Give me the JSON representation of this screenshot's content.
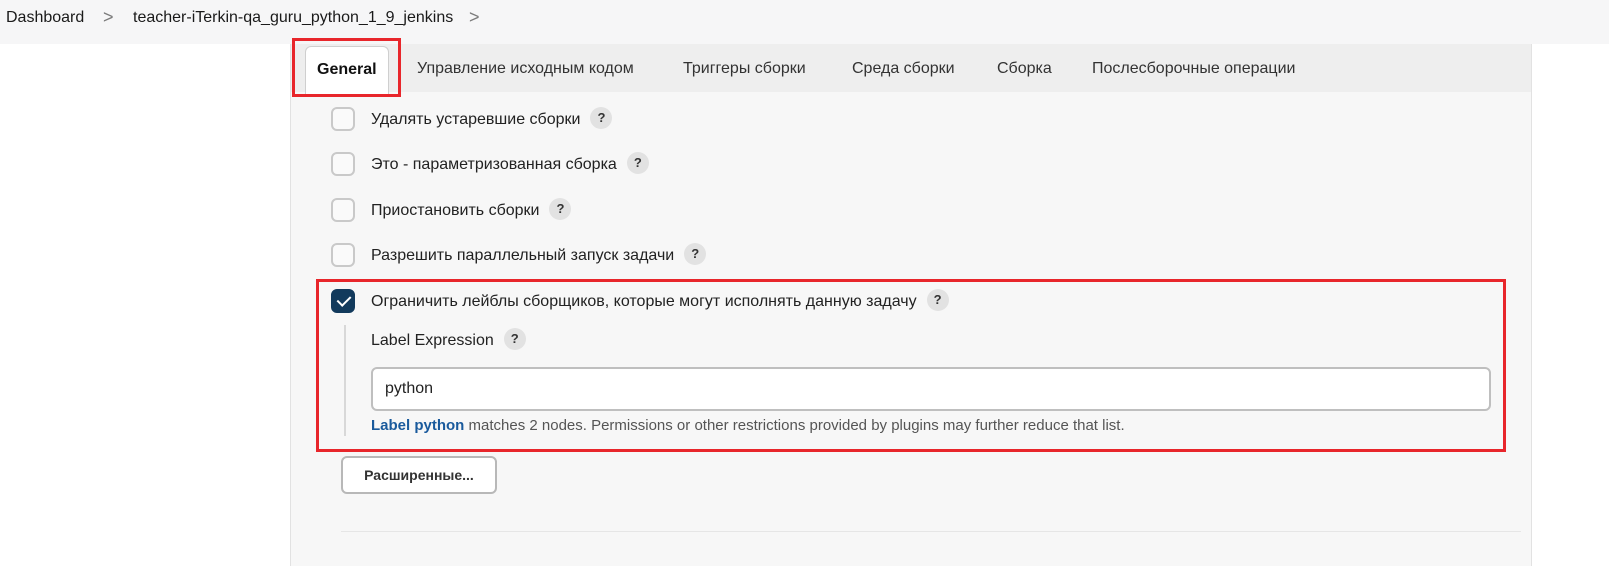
{
  "breadcrumb": {
    "items": [
      "Dashboard",
      "teacher-iTerkin-qa_guru_python_1_9_jenkins"
    ],
    "separator": ">"
  },
  "tabs": [
    {
      "label": "General",
      "active": true
    },
    {
      "label": "Управление исходным кодом",
      "active": false
    },
    {
      "label": "Триггеры сборки",
      "active": false
    },
    {
      "label": "Среда сборки",
      "active": false
    },
    {
      "label": "Сборка",
      "active": false
    },
    {
      "label": "Послесборочные операции",
      "active": false
    }
  ],
  "options": [
    {
      "label": "Удалять устаревшие сборки",
      "checked": false
    },
    {
      "label": "Это - параметризованная сборка",
      "checked": false
    },
    {
      "label": "Приостановить сборки",
      "checked": false
    },
    {
      "label": "Разрешить параллельный запуск задачи",
      "checked": false
    },
    {
      "label": "Ограничить лейблы сборщиков, которые могут исполнять данную задачу",
      "checked": true
    }
  ],
  "help_glyph": "?",
  "label_expression": {
    "label": "Label Expression",
    "value": "python",
    "validation_link": "Label python",
    "validation_text": " matches 2 nodes. Permissions or other restrictions provided by plugins may further reduce that list."
  },
  "advanced_button": "Расширенные...",
  "colors": {
    "highlight": "#e8262b",
    "checkbox_checked": "#123a5c",
    "link": "#1a5a9c"
  }
}
